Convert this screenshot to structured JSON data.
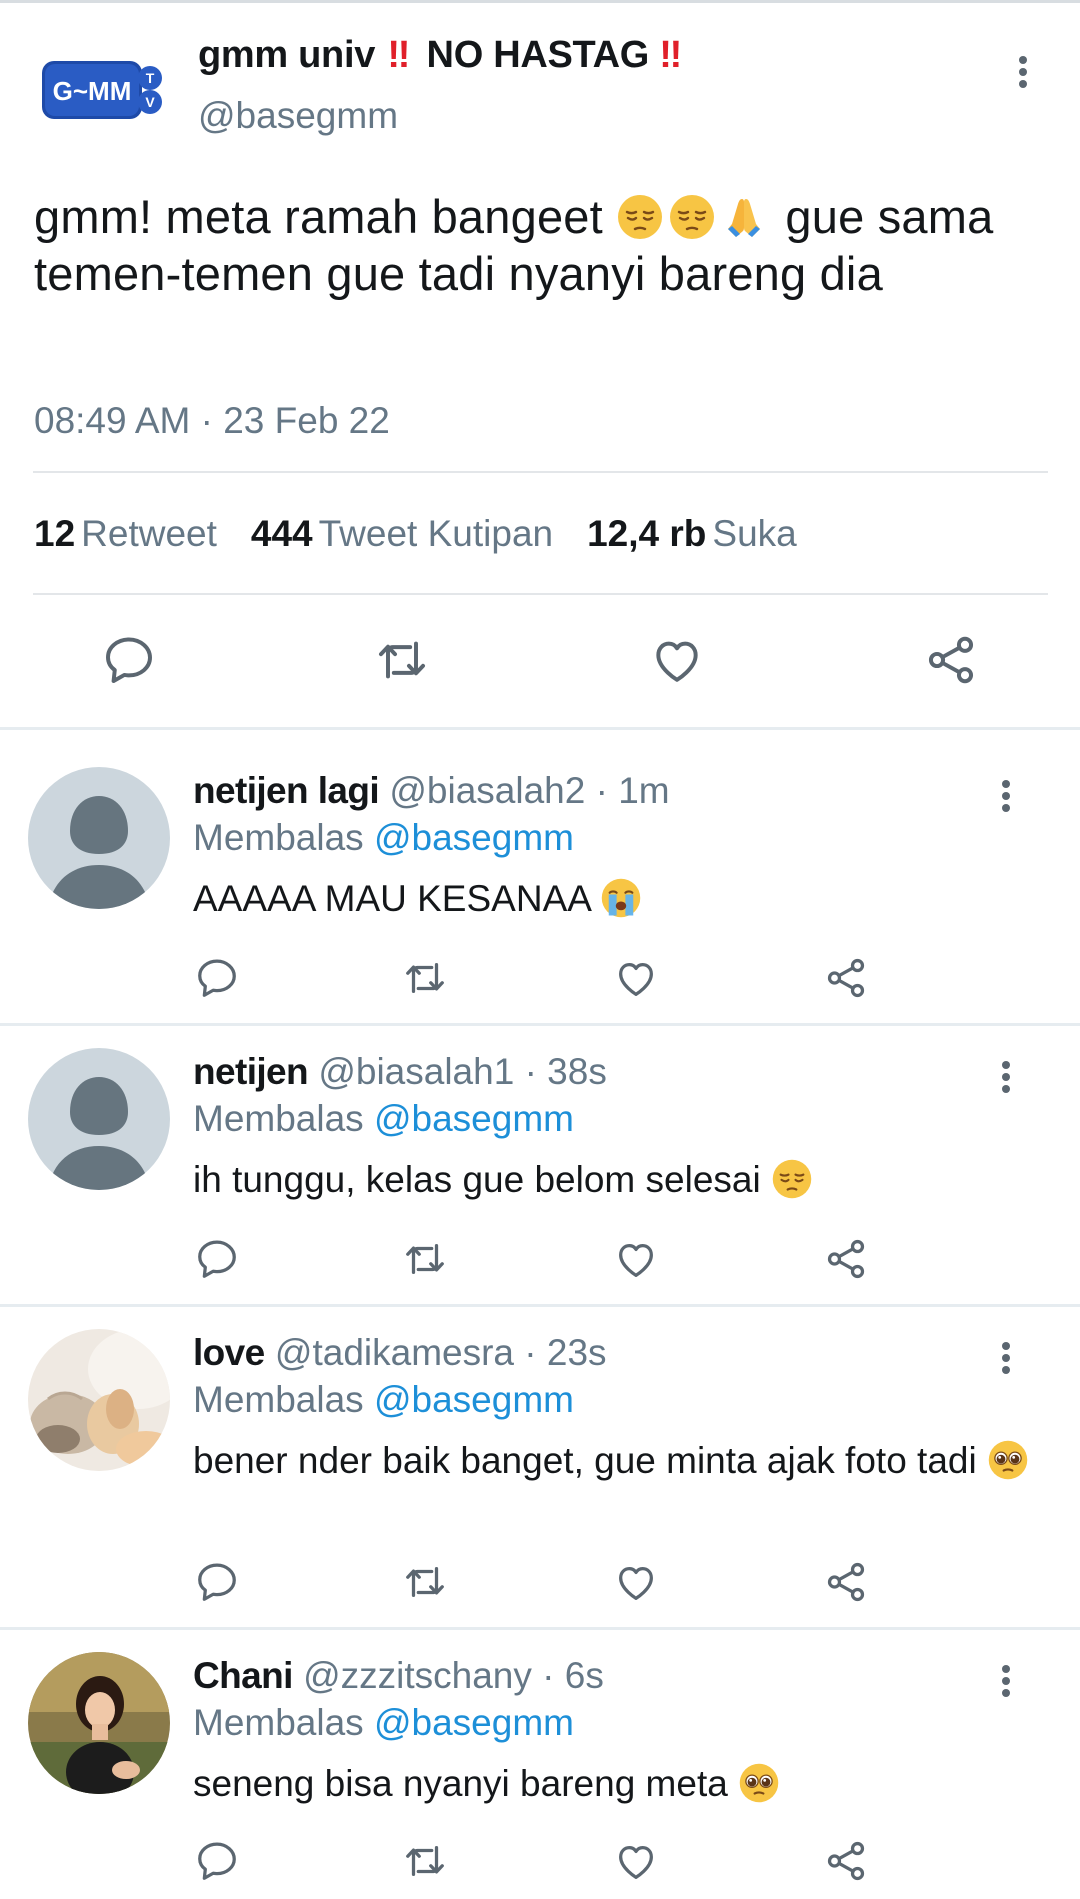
{
  "tweet": {
    "display_name_part1": "gmm univ",
    "display_name_part2": "NO HASTAG",
    "bang": "‼",
    "handle": "@basegmm",
    "logo_text": "G~MM",
    "logo_badge": "TV",
    "text_part1": "gmm! meta ramah bangeet",
    "text_part2": "gue sama temen-temen gue tadi nyanyi bareng dia",
    "text_emojis": [
      "pensive-face",
      "pensive-face",
      "folded-hands"
    ],
    "timestamp": "08:49 AM · 23 Feb 22",
    "stats": {
      "retweet_count": "12",
      "retweet_label": "Retweet",
      "quote_count": "444",
      "quote_label": "Tweet Kutipan",
      "like_count": "12,4 rb",
      "like_label": "Suka"
    },
    "actions": [
      "reply-icon",
      "retweet-icon",
      "like-icon",
      "share-icon"
    ]
  },
  "replies": [
    {
      "name": "netijen lagi",
      "handle": "@biasalah2",
      "time": "· 1m",
      "replying_to_label": "Membalas",
      "replying_to_handle": "@basegmm",
      "text": "AAAAA MAU KESANAA",
      "emoji": "loudly-crying-face",
      "avatar": "default-avatar"
    },
    {
      "name": "netijen",
      "handle": "@biasalah1",
      "time": "· 38s",
      "replying_to_label": "Membalas",
      "replying_to_handle": "@basegmm",
      "text": "ih tunggu, kelas gue belom selesai",
      "emoji": "pensive-face",
      "avatar": "default-avatar"
    },
    {
      "name": "love",
      "handle": "@tadikamesra",
      "time": "· 23s",
      "replying_to_label": "Membalas",
      "replying_to_handle": "@basegmm",
      "text": "bener nder baik banget, gue minta ajak foto tadi",
      "emoji": "pleading-face",
      "avatar": "cat-photo-avatar"
    },
    {
      "name": "Chani",
      "handle": "@zzzitschany",
      "time": "· 6s",
      "replying_to_label": "Membalas",
      "replying_to_handle": "@basegmm",
      "text": "seneng bisa nyanyi bareng meta",
      "emoji": "pleading-face",
      "avatar": "person-photo-avatar"
    }
  ],
  "colors": {
    "text_primary": "#14171a",
    "text_secondary": "#657786",
    "link_blue": "#1d8fd8",
    "icon_gray": "#5b6670",
    "divider": "#e6ecf0"
  }
}
